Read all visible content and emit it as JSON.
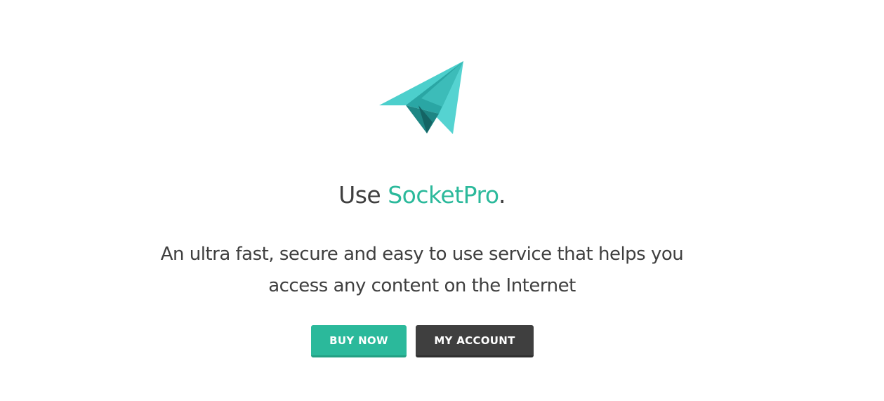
{
  "logo": {
    "icon": "paper-plane-icon",
    "colors": [
      "#4fd1cf",
      "#2aa6a4",
      "#1e7f7f",
      "#146464"
    ]
  },
  "hero": {
    "headline_prefix": "Use ",
    "brand": "SocketPro",
    "headline_suffix": ".",
    "tagline_line1": "An ultra fast, secure and easy to use service that helps you",
    "tagline_line2": "access any content on the Internet"
  },
  "actions": {
    "buy_label": "BUY NOW",
    "account_label": "MY ACCOUNT"
  },
  "colors": {
    "accent": "#2bb99b",
    "text": "#3f3f3f",
    "dark_button": "#3f3f3f",
    "background": "#ffffff"
  }
}
